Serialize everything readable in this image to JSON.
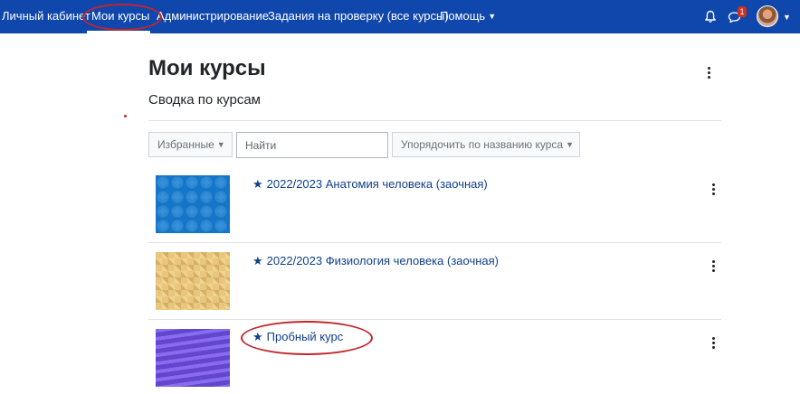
{
  "navbar": {
    "items": [
      {
        "label": "Личный кабинет"
      },
      {
        "label": "Мои курсы"
      },
      {
        "label": "Администрирование"
      },
      {
        "label": "Задания на проверку (все курсы)"
      },
      {
        "label": "Помощь"
      }
    ],
    "messages_badge": "1",
    "bg_color": "#0f47ad"
  },
  "page": {
    "title": "Мои курсы",
    "subtitle": "Сводка по курсам"
  },
  "filters": {
    "grouping_label": "Избранные",
    "search_placeholder": "Найти",
    "sort_label": "Упорядочить по названию курса"
  },
  "courses": [
    {
      "name": "2022/2023 Анатомия человека (заочная)",
      "starred": true
    },
    {
      "name": "2022/2023 Физиология человека (заочная)",
      "starred": true
    },
    {
      "name": "Пробный курс",
      "starred": true
    }
  ],
  "icons": {
    "bell": "bell-icon",
    "messages": "chat-icon",
    "star": "star-icon",
    "kebab": "more-vertical-icon"
  },
  "colors": {
    "accent": "#0f47ad",
    "link": "#0f3f8a",
    "annotation": "#c1262b"
  }
}
